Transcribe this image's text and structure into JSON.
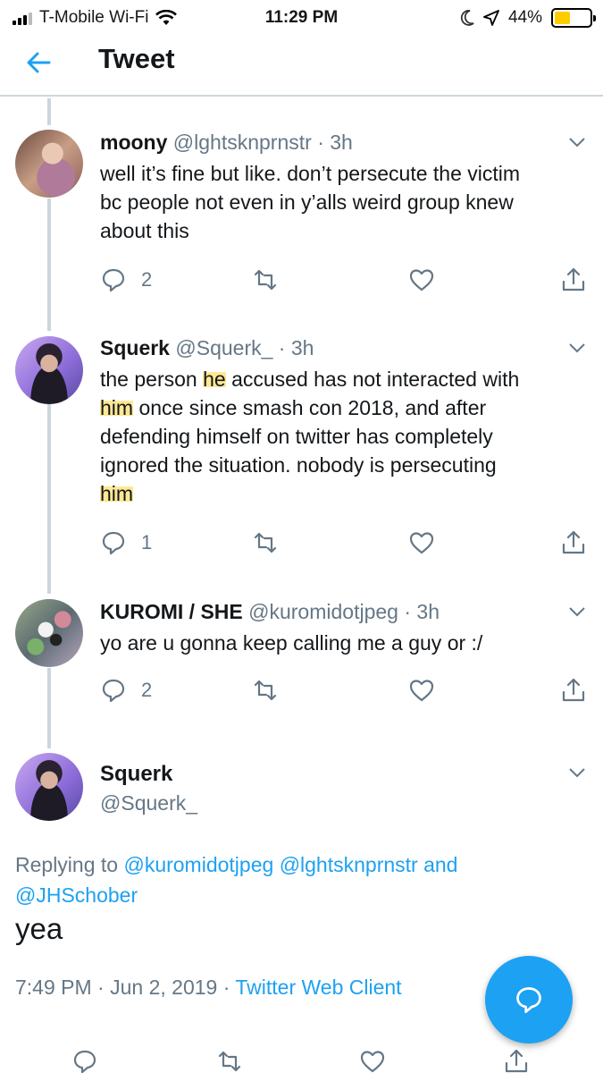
{
  "status_bar": {
    "carrier": "T-Mobile Wi-Fi",
    "time": "11:29 PM",
    "battery_percent_label": "44%",
    "battery_level": 0.44,
    "icons": [
      "signal-icon",
      "wifi-icon",
      "moon-icon",
      "location-icon",
      "battery-icon"
    ]
  },
  "header": {
    "title": "Tweet",
    "back_icon": "arrow-left-icon"
  },
  "colors": {
    "accent": "#1da1f2",
    "muted": "#657786",
    "text": "#14171a",
    "divider": "#ccd6dd",
    "highlight": "#ffd63c"
  },
  "replies": [
    {
      "name": "moony",
      "handle": "@lghtsknprnstr",
      "time": "3h",
      "lines": [
        "well it’s fine but like. don’t persecute the victim",
        "bc people not even in y’alls weird group knew",
        "about this"
      ],
      "reply_count": "2"
    },
    {
      "name": "Squerk",
      "handle": "@Squerk_",
      "time": "3h",
      "segments": {
        "a": "the person ",
        "b": "he",
        "c": " accused has not interacted with",
        "d": "him",
        "e": " once since smash con 2018, and after",
        "f": "defending himself on twitter has completely",
        "g": "ignored the situation.  nobody is persecuting",
        "h": "him"
      },
      "reply_count": "1"
    },
    {
      "name": "KUROMI / SHE",
      "handle": "@kuromidotjpeg",
      "time": "3h",
      "lines": [
        "yo are u gonna keep calling me a guy or :/"
      ],
      "reply_count": "2"
    }
  ],
  "main_tweet": {
    "name": "Squerk",
    "handle": "@Squerk_",
    "replying_prefix": "Replying to ",
    "mention_1": "@kuromidotjpeg",
    "mention_2": "@lghtsknprnstr",
    "and_word": "and",
    "mention_3": "@JHSchober",
    "text": "yea",
    "time": "7:49 PM",
    "date": "Jun 2, 2019",
    "client": "Twitter Web Client"
  },
  "dot": "·",
  "fab_icon": "compose-reply-icon"
}
